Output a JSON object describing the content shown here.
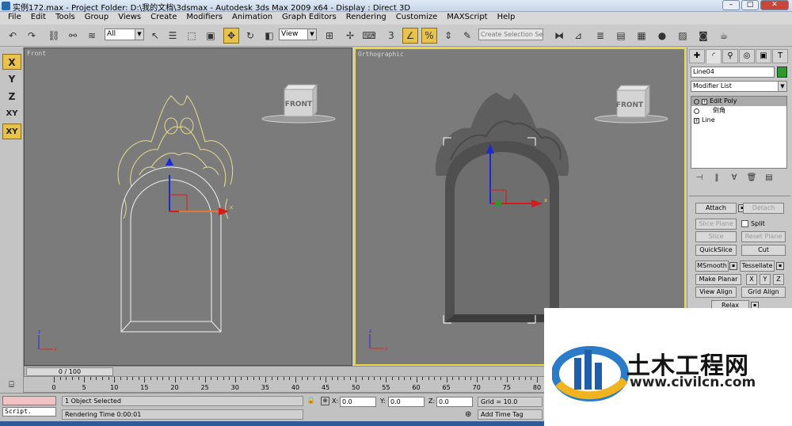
{
  "window": {
    "title": "实例172.max    - Project Folder: D:\\我的文档\\3dsmax     - Autodesk 3ds Max  2009 x64      - Display : Direct 3D",
    "min": "–",
    "max": "□",
    "close": "✕"
  },
  "menu": [
    "File",
    "Edit",
    "Tools",
    "Group",
    "Views",
    "Create",
    "Modifiers",
    "Animation",
    "Graph Editors",
    "Rendering",
    "Customize",
    "MAXScript",
    "Help"
  ],
  "toolbar": {
    "selection_filter": "All",
    "ref_coord": "View",
    "named_selection_placeholder": "Create Selection Set",
    "snap_label": "3"
  },
  "axis_constraints": [
    "X",
    "Y",
    "Z",
    "XY",
    "XY"
  ],
  "viewports": {
    "left": {
      "label": "Front",
      "viewcube": "FRONT"
    },
    "right": {
      "label": "Orthographic",
      "viewcube": "FRONT"
    }
  },
  "command_panel": {
    "object_name": "Line04",
    "object_color": "#2d9a2d",
    "modifier_list": "Modifier List",
    "stack": [
      "Edit Poly",
      "倒角",
      "Line"
    ],
    "buttons": {
      "attach": "Attach",
      "detach": "Detach",
      "slice_plane": "Slice Plane",
      "split": "Split",
      "slice": "Slice",
      "reset_plane": "Reset Plane",
      "quickslice": "QuickSlice",
      "cut": "Cut",
      "msmooth": "MSmooth",
      "tessellate": "Tessellate",
      "make_planar": "Make Planar",
      "x": "X",
      "y": "Y",
      "z": "Z",
      "view_align": "View Align",
      "grid_align": "Grid Align",
      "relax": "Relax"
    }
  },
  "timeline": {
    "slider_label": "0 / 100",
    "ticks": [
      0,
      5,
      10,
      15,
      20,
      25,
      30,
      35,
      40,
      45,
      50,
      55,
      60,
      65,
      70,
      75,
      80
    ]
  },
  "status": {
    "selection": "1 Object Selected",
    "render_time": "Rendering Time  0:00:01",
    "x_label": "X:",
    "x": "0.0",
    "y_label": "Y:",
    "y": "0.0",
    "z_label": "Z:",
    "z": "0.0",
    "grid": "Grid = 10.0",
    "add_time_tag": "Add Time Tag",
    "script": "Script."
  },
  "watermark": {
    "text": "土木工程网",
    "url": "www.civilcn.com"
  }
}
